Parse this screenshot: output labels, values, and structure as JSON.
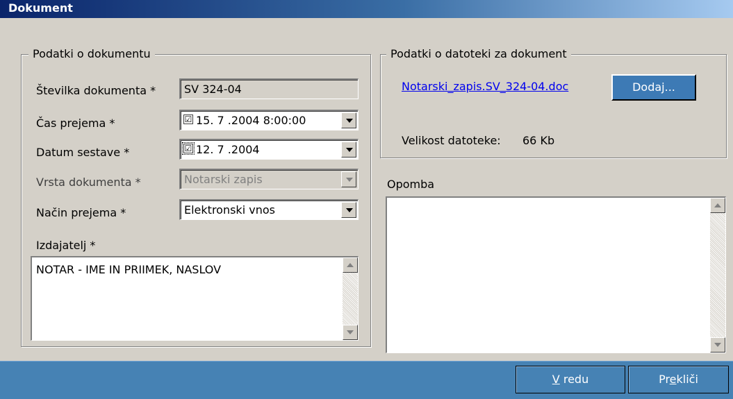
{
  "window": {
    "title": "Dokument"
  },
  "document_group": {
    "legend": "Podatki o dokumentu",
    "stevilka": {
      "label": "Številka dokumenta *",
      "value": "SV 324-04"
    },
    "cas_prejema": {
      "label": "Čas prejema *",
      "value": "15. 7 .2004   8:00:00",
      "checked": "☑"
    },
    "datum_sestave": {
      "label": "Datum sestave *",
      "value": "12. 7 .2004",
      "checked": "☑"
    },
    "vrsta": {
      "label": "Vrsta dokumenta *",
      "value": "Notarski zapis"
    },
    "nacin": {
      "label": "Način prejema *",
      "value": "Elektronski vnos"
    },
    "izdajatelj": {
      "label": "Izdajatelj *",
      "value": "NOTAR - IME IN PRIIMEK, NASLOV"
    }
  },
  "file_group": {
    "legend": "Podatki o datoteki za dokument",
    "file_link": "Notarski_zapis.SV_324-04.doc",
    "add_button": "Dodaj...",
    "size_label": "Velikost datoteke:",
    "size_value": "66 Kb"
  },
  "opomba": {
    "label": "Opomba",
    "value": ""
  },
  "footer": {
    "ok_mnemonic": "V",
    "ok_rest": " redu",
    "cancel_pre": "Pr",
    "cancel_mnemonic": "e",
    "cancel_post": "kliči"
  },
  "colors": {
    "accent": "#4682b4",
    "title_start": "#0a246a",
    "title_end": "#a6caf0",
    "link": "#0000ee"
  }
}
